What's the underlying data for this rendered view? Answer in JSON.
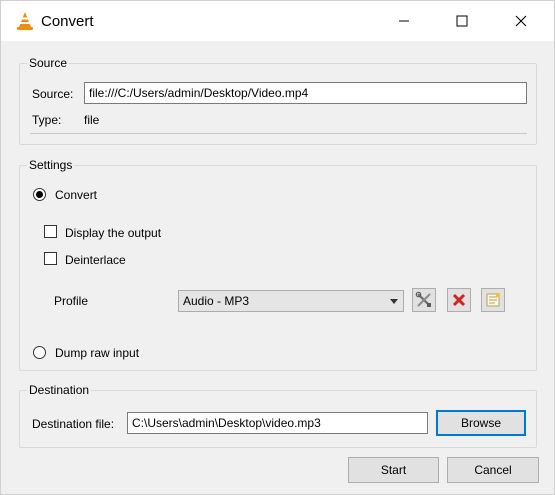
{
  "window": {
    "title": "Convert"
  },
  "source": {
    "group_title": "Source",
    "source_label": "Source:",
    "source_value": "file:///C:/Users/admin/Desktop/Video.mp4",
    "type_label": "Type:",
    "type_value": "file"
  },
  "settings": {
    "group_title": "Settings",
    "convert_label": "Convert",
    "convert_selected": true,
    "display_output_label": "Display the output",
    "display_output_checked": false,
    "deinterlace_label": "Deinterlace",
    "deinterlace_checked": false,
    "profile_label": "Profile",
    "profile_value": "Audio - MP3",
    "dump_raw_label": "Dump raw input",
    "dump_raw_selected": false
  },
  "destination": {
    "group_title": "Destination",
    "file_label": "Destination file:",
    "file_value": "C:\\Users\\admin\\Desktop\\video.mp3",
    "browse_label": "Browse"
  },
  "actions": {
    "start_label": "Start",
    "cancel_label": "Cancel"
  },
  "icons": {
    "app": "vlc-cone-icon",
    "edit_profile": "tools-icon",
    "delete_profile": "red-x-icon",
    "new_profile": "new-document-icon"
  },
  "colors": {
    "accent": "#0078d7",
    "delete_red": "#d32020",
    "vlc_orange": "#f28c0f"
  }
}
